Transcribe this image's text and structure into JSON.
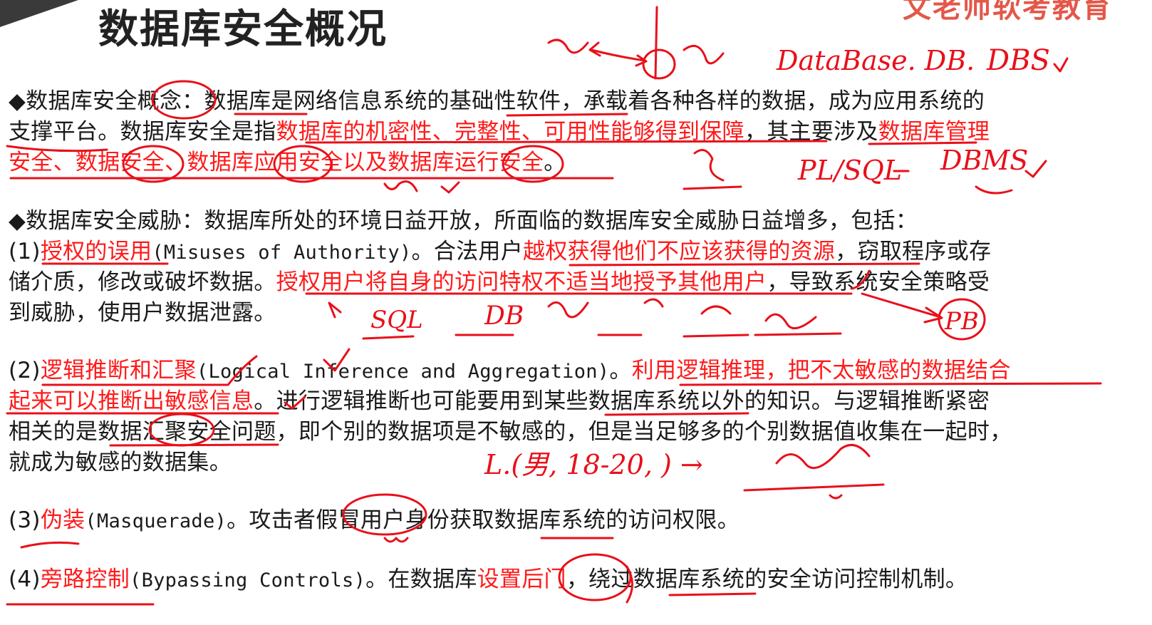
{
  "slide": {
    "title": "数据库安全概况",
    "brand_partial": "文老师软考教育"
  },
  "concept": {
    "line1": "◆数据库安全概念：数据库是网络信息系统的基础性软件，承载着各种各样的数据，成为应用系统的",
    "line2_a": "支撑平台。数据库安全是指",
    "line2_red": "数据库的机密性、完整性、可用性能够得到保障",
    "line2_b": "，其主要涉及",
    "line2_red2": "数据库管理",
    "line3_red": "安全、数据安全、数据库应用安全以及数据库运行安全",
    "line3_b": "。"
  },
  "threats": {
    "heading": "◆数据库安全威胁：数据库所处的环境日益开放，所面临的数据库安全威胁日益增多，包括：",
    "t1": {
      "num": "(1)",
      "name": "授权的误用",
      "latin": "(Misuses of Authority)",
      "l1_a": "。合法用户",
      "l1_red": "越权获得他们不应该获得的资源",
      "l1_b": "，窃取程序或存",
      "l2_a": "储介质，修改或破坏数据。",
      "l2_red": "授权用户将自身的访问特权不适当地授予其他用户",
      "l2_b": "，导致系统安全策略受",
      "l3": "到威胁，使用户数据泄露。"
    },
    "t2": {
      "num": "(2)",
      "name": "逻辑推断和汇聚",
      "latin": "(Logical Inference and Aggregation)",
      "l1_a": "。",
      "l1_red": "利用逻辑推理，把不太敏感的数据结合",
      "l2_red": "起来可以推断出敏感信息",
      "l2_b": "。进行逻辑推断也可能要用到某些数据库系统以外的知识。与逻辑推断紧密",
      "l3": "相关的是数据汇聚安全问题，即个别的数据项是不敏感的，但是当足够多的个别数据值收集在一起时，",
      "l4": "就成为敏感的数据集。"
    },
    "t3": {
      "num": "(3)",
      "name": "伪装",
      "latin": "(Masquerade)",
      "text": "。攻击者假冒用户身份获取数据库系统的访问权限。"
    },
    "t4": {
      "num": "(4)",
      "name": "旁路控制",
      "latin": "(Bypassing Controls)",
      "text_a": "。在数据库",
      "text_red": "设置后门",
      "text_b": "，绕过数据库系统的安全访问控制机制。"
    }
  },
  "handwriting": {
    "note_database": "DataBase. DB.",
    "note_dbs": "DBS",
    "note_plsql": "PL/SQL",
    "note_dbms": "DBMS",
    "note_sql": "SQL",
    "note_db": "DB",
    "note_pb": "PB",
    "note_tuple": "L.(男, 18-20, ) →",
    "colors": {
      "ink": "#e8101a",
      "red_text": "#ff1a1a",
      "black_text": "#1a1a1a"
    }
  }
}
